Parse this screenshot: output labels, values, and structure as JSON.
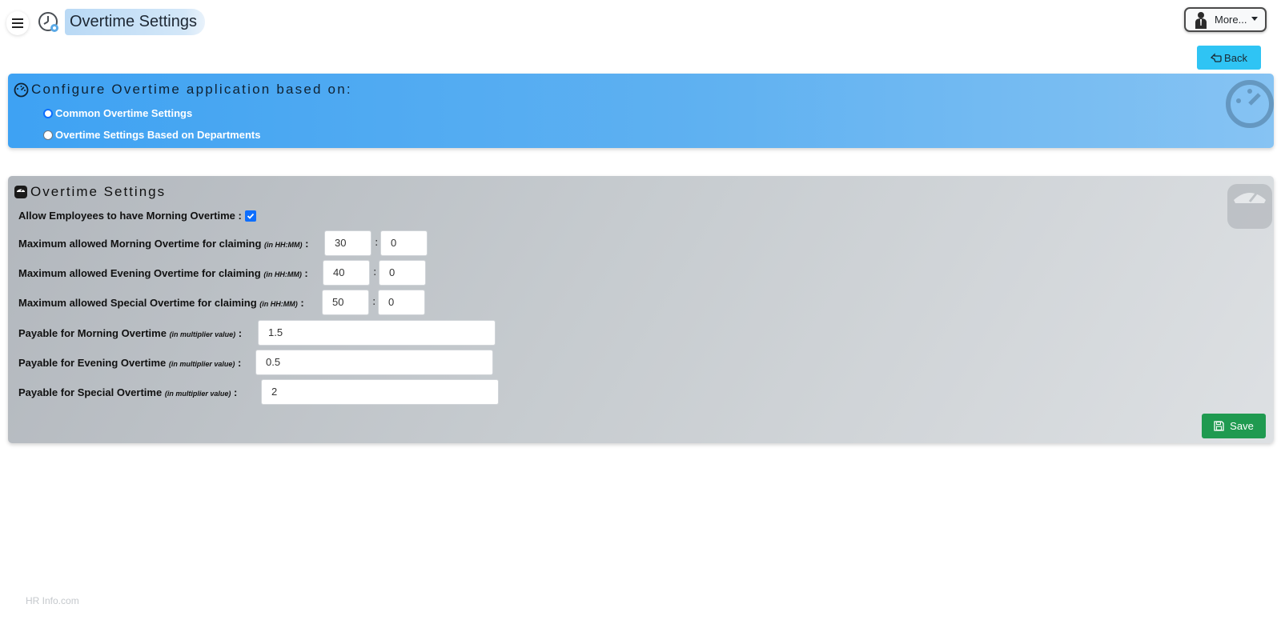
{
  "header": {
    "title": "Overtime Settings",
    "more_label": "More...",
    "back_label": "Back"
  },
  "config_panel": {
    "title": "Configure Overtime application based on:",
    "options": [
      {
        "label": "Common Overtime Settings",
        "checked": true
      },
      {
        "label": "Overtime Settings Based on Departments",
        "checked": false
      }
    ]
  },
  "settings_panel": {
    "title": "Overtime Settings",
    "morning_toggle": {
      "label": "Allow Employees to have Morning Overtime :",
      "checked": true
    },
    "max_morning": {
      "label": "Maximum allowed Morning Overtime for claiming",
      "hint": "(in HH:MM)",
      "suffix": " :",
      "hours": "30",
      "minutes": "0"
    },
    "max_evening": {
      "label": "Maximum allowed Evening Overtime for claiming",
      "hint": "(in HH:MM)",
      "suffix": " :",
      "hours": "40",
      "minutes": "0"
    },
    "max_special": {
      "label": "Maximum allowed Special Overtime for claiming",
      "hint": "(in HH:MM)",
      "suffix": " :",
      "hours": "50",
      "minutes": "0"
    },
    "pay_morning": {
      "label": "Payable for Morning Overtime",
      "hint": "(in multiplier value)",
      "suffix": " :",
      "value": "1.5"
    },
    "pay_evening": {
      "label": "Payable for Evening Overtime",
      "hint": "(in multiplier value)",
      "suffix": " :",
      "value": "0.5"
    },
    "pay_special": {
      "label": "Payable for Special Overtime",
      "hint": "(in multiplier value)",
      "suffix": " :",
      "value": "2"
    },
    "save_label": "Save"
  },
  "footer": {
    "text": "HR Info.com"
  },
  "colors": {
    "accent": "#0d6efd",
    "back_button": "#2fc4f4",
    "save_button": "#1f9a50",
    "blue_panel": "#3ea2f3"
  }
}
